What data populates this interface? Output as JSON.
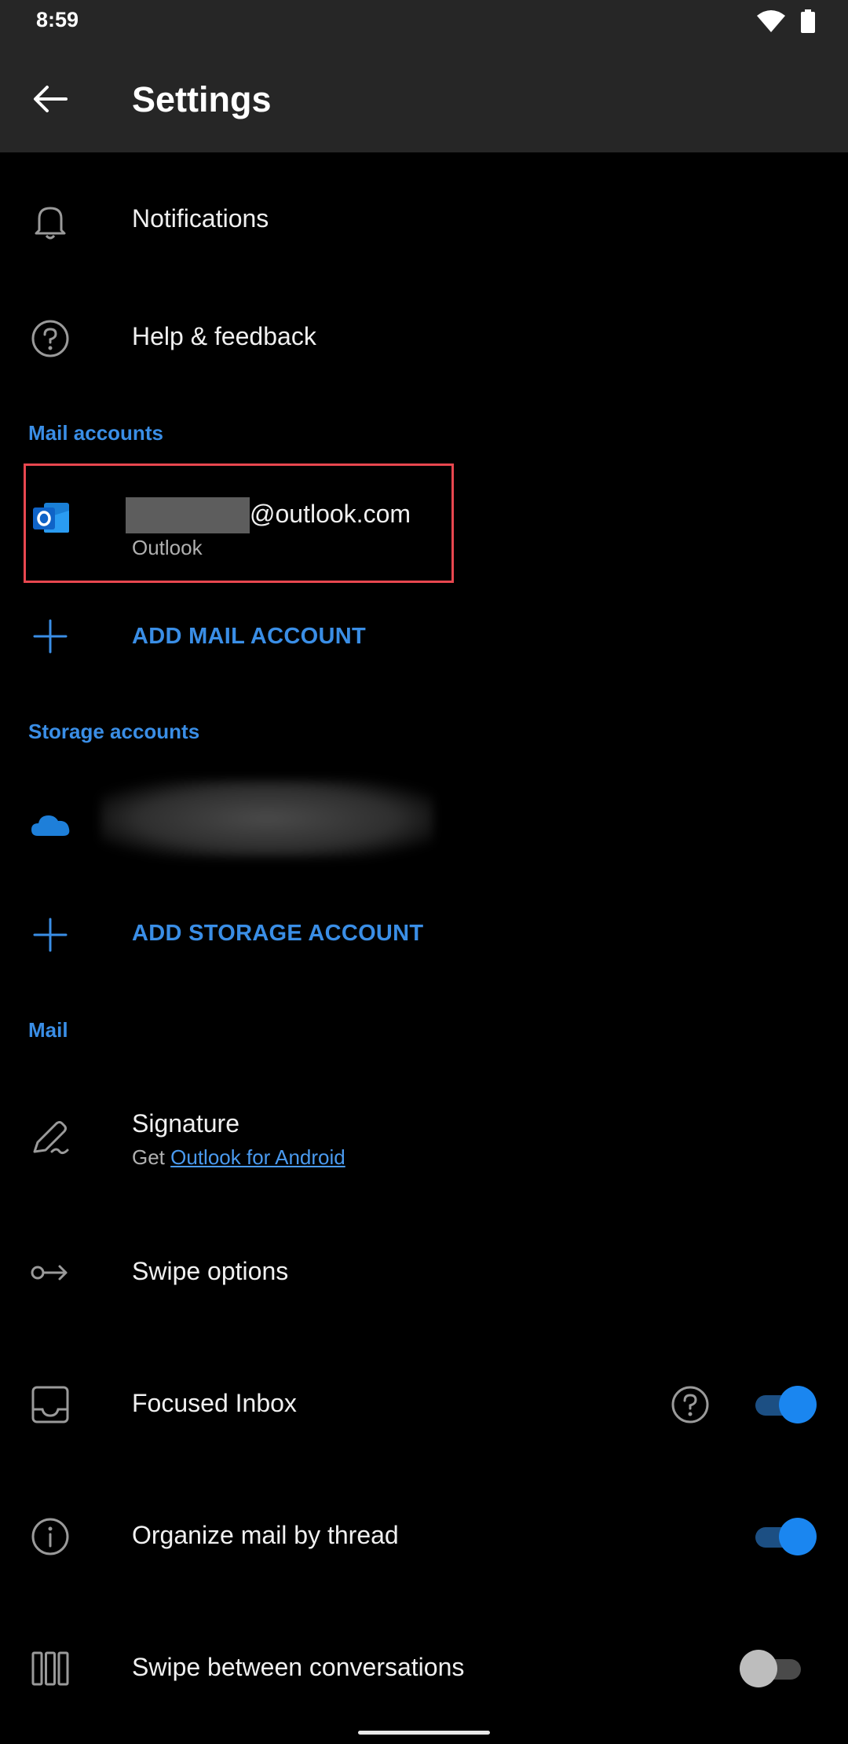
{
  "status": {
    "time": "8:59"
  },
  "appbar": {
    "title": "Settings"
  },
  "items": {
    "notifications": "Notifications",
    "help": "Help & feedback"
  },
  "sections": {
    "mail_accounts": "Mail accounts",
    "storage_accounts": "Storage accounts",
    "mail": "Mail"
  },
  "mail_account": {
    "email_suffix": "@outlook.com",
    "provider": "Outlook"
  },
  "actions": {
    "add_mail": "ADD MAIL ACCOUNT",
    "add_storage": "ADD STORAGE ACCOUNT"
  },
  "mail_settings": {
    "signature": "Signature",
    "signature_sub_prefix": "Get ",
    "signature_sub_link": "Outlook for Android",
    "swipe_options": "Swipe options",
    "focused_inbox": "Focused Inbox",
    "organize_thread": "Organize mail by thread",
    "swipe_conversations": "Swipe between conversations"
  },
  "toggles": {
    "focused_inbox": true,
    "organize_thread": true,
    "swipe_conversations": false
  },
  "colors": {
    "accent": "#3a8ee6",
    "highlight_border": "#e8474f",
    "toggle_on": "#1a86f0"
  }
}
